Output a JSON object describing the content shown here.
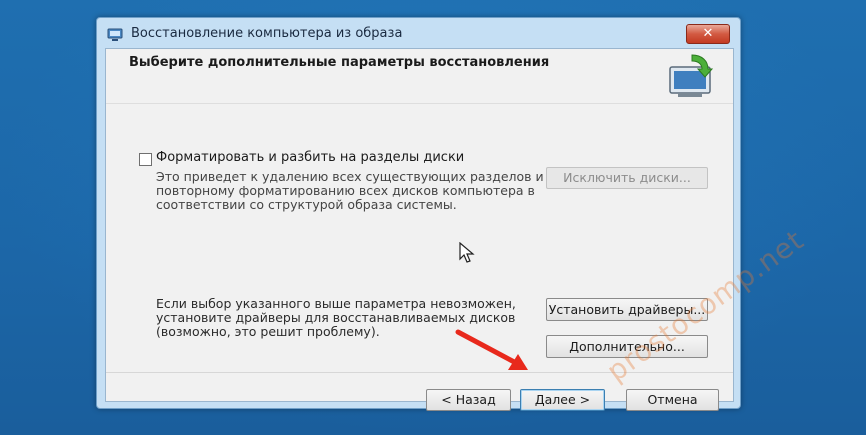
{
  "window": {
    "title": "Восстановление компьютера из образа",
    "close_label": "✕",
    "header_title": "Выберите дополнительные параметры восстановления"
  },
  "format_option": {
    "checked": false,
    "label": "Форматировать и разбить на разделы диски",
    "description_lines": [
      "Это приведет к удалению всех существующих разделов и",
      "повторному форматированию всех дисков компьютера в",
      "соответствии со структурой образа системы."
    ],
    "exclude_button": "Исключить диски..."
  },
  "drivers": {
    "description_lines": [
      "Если выбор указанного выше параметра невозможен,",
      "установите драйверы для восстанавливаемых дисков",
      "(возможно, это решит проблему)."
    ],
    "install_button": "Установить драйверы...",
    "advanced_button": "Дополнительно..."
  },
  "footer": {
    "back_button": "< Назад",
    "next_button": "Далее >",
    "cancel_button": "Отмена"
  },
  "watermark": "prostocomp.net",
  "colors": {
    "desktop": "#1f6fb0",
    "window_frame": "#c5dff4",
    "client_bg": "#f1f1f1",
    "arrow": "#e8291c"
  },
  "icons": [
    "app-icon",
    "backup-restore-icon",
    "mouse-cursor-icon",
    "red-arrow-annotation"
  ]
}
